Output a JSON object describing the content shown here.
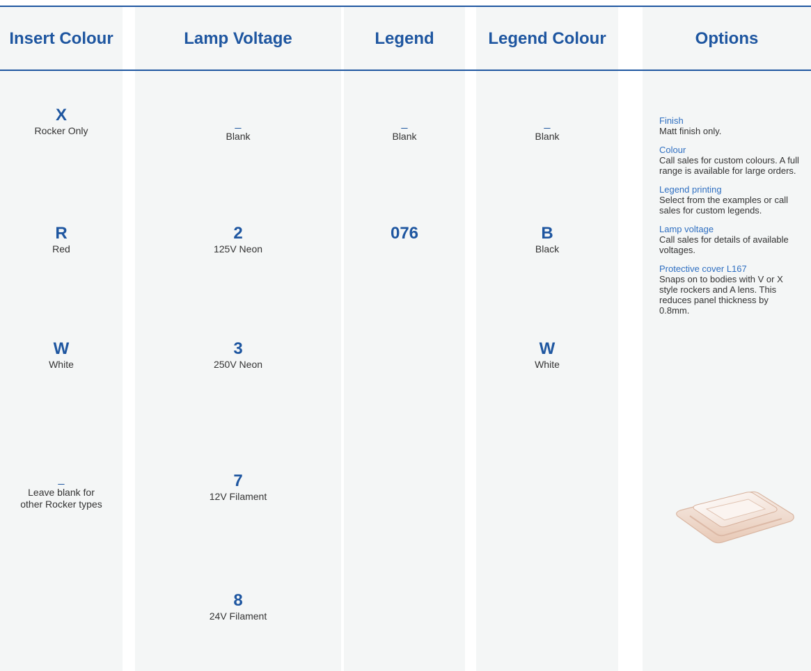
{
  "columns": {
    "insert_colour": {
      "header": "Insert Colour",
      "entries": [
        {
          "code": "X",
          "desc": "Rocker Only"
        },
        {
          "code": "R",
          "desc": "Red"
        },
        {
          "code": "W",
          "desc": "White"
        },
        {
          "code": "_",
          "desc": "Leave blank for other Rocker types"
        }
      ]
    },
    "lamp_voltage": {
      "header": "Lamp Voltage",
      "entries": [
        {
          "code": "_",
          "desc": "Blank"
        },
        {
          "code": "2",
          "desc": "125V Neon"
        },
        {
          "code": "3",
          "desc": "250V Neon"
        },
        {
          "code": "7",
          "desc": "12V Filament"
        },
        {
          "code": "8",
          "desc": "24V Filament"
        }
      ]
    },
    "legend": {
      "header": "Legend",
      "entries": [
        {
          "code": "_",
          "desc": "Blank"
        },
        {
          "code": "076",
          "desc": ""
        }
      ]
    },
    "legend_colour": {
      "header": "Legend Colour",
      "entries": [
        {
          "code": "_",
          "desc": "Blank"
        },
        {
          "code": "B",
          "desc": "Black"
        },
        {
          "code": "W",
          "desc": "White"
        }
      ]
    },
    "options": {
      "header": "Options",
      "items": [
        {
          "title": "Finish",
          "body": "Matt finish only."
        },
        {
          "title": "Colour",
          "body": "Call sales for custom colours. A full range is available for large orders."
        },
        {
          "title": "Legend printing",
          "body": "Select from the examples or call sales for custom legends."
        },
        {
          "title": "Lamp voltage",
          "body": "Call sales for details of available voltages."
        },
        {
          "title": "Protective cover L167",
          "body": "Snaps on to bodies with V or X style rockers and A lens. This reduces panel thickness by 0.8mm."
        }
      ]
    }
  },
  "colors": {
    "accent": "#1e56a0",
    "option_title": "#2f6fc1",
    "column_bg": "#f4f6f6",
    "text": "#333333"
  },
  "images": {
    "protective_cover": "protective-cover-image"
  }
}
